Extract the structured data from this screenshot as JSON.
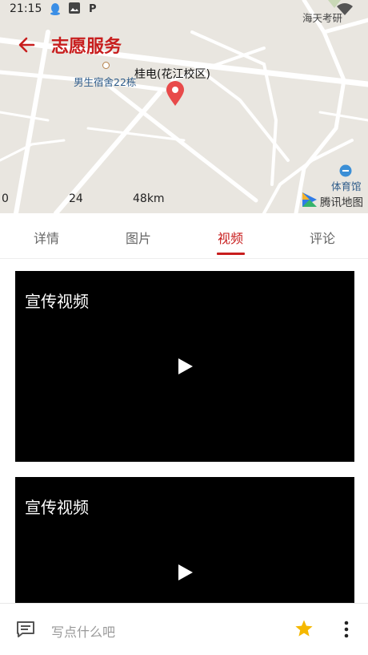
{
  "status_bar": {
    "time": "21:15",
    "icons": [
      "qq-icon",
      "image-icon",
      "parking-icon",
      "wifi-icon"
    ]
  },
  "header": {
    "title": "志愿服务",
    "back_icon": "arrow-left-icon",
    "accent_color": "#c81e1e"
  },
  "map": {
    "labels": {
      "top_right": "海天考研",
      "dorm": "男生宿舍22栋",
      "campus": "桂电(花江校区)",
      "gym": "体育馆",
      "provider": "腾讯地图"
    },
    "scale": {
      "tick0": "0",
      "tick1": "24",
      "tick2": "48km"
    }
  },
  "tabs": {
    "items": [
      {
        "label": "详情"
      },
      {
        "label": "图片"
      },
      {
        "label": "视频"
      },
      {
        "label": "评论"
      }
    ],
    "active_index": 2
  },
  "videos": [
    {
      "title": "宣传视频"
    },
    {
      "title": "宣传视频"
    }
  ],
  "bottom_bar": {
    "placeholder": "写点什么吧",
    "star_color": "#f5b800"
  }
}
